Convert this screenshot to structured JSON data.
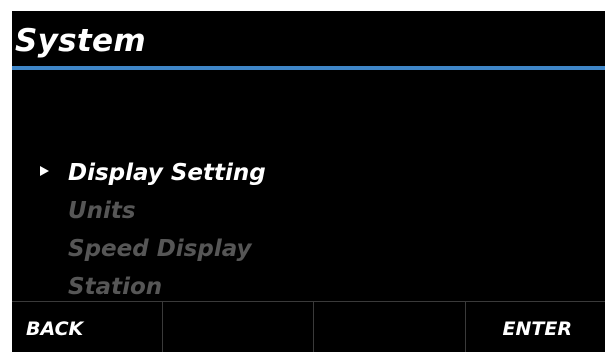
{
  "header": {
    "title": "System",
    "accent_color": "#3f86c8"
  },
  "menu": {
    "selected_index": 0,
    "selector_icon": "right-triangle-icon",
    "items": [
      {
        "label": "Display Setting",
        "state": "selected"
      },
      {
        "label": "Units",
        "state": "dim"
      },
      {
        "label": "Speed Display",
        "state": "dim"
      },
      {
        "label": "Station",
        "state": "dim"
      }
    ]
  },
  "softkeys": {
    "back": "BACK",
    "key2": "",
    "key3": "",
    "enter": "ENTER"
  }
}
